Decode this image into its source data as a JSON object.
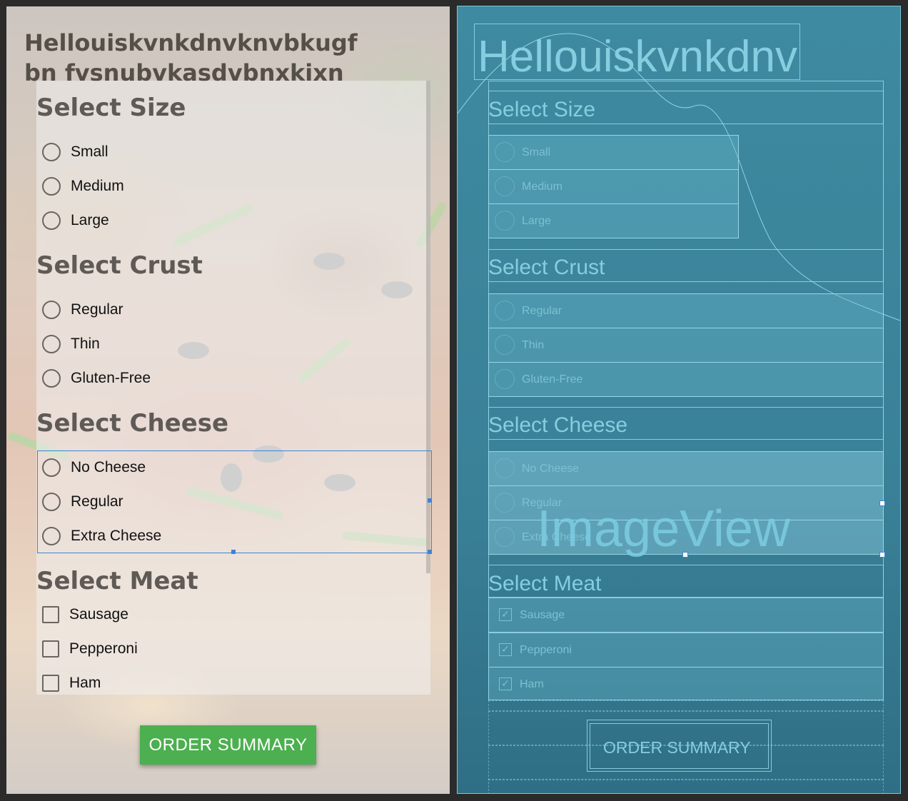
{
  "app": {
    "title": "Hellouiskvnkdnvknvbkugfbn fvsnubvkasdvbnxkixnb",
    "title_blueprint": "Hellouiskvnkdnv"
  },
  "sections": {
    "size": {
      "heading": "Select Size",
      "options": [
        "Small",
        "Medium",
        "Large"
      ]
    },
    "crust": {
      "heading": "Select Crust",
      "options": [
        "Regular",
        "Thin",
        "Gluten-Free"
      ]
    },
    "cheese": {
      "heading": "Select Cheese",
      "options": [
        "No Cheese",
        "Regular",
        "Extra Cheese"
      ]
    },
    "meat": {
      "heading": "Select Meat",
      "options": [
        "Sausage",
        "Pepperoni",
        "Ham"
      ]
    }
  },
  "order_button": {
    "label": "ORDER SUMMARY"
  },
  "blueprint": {
    "imageview_label": "ImageView"
  },
  "colors": {
    "button_green": "#4caf50",
    "selection_blue": "#3d84d6",
    "blueprint_bg": "#2d6d82",
    "blueprint_line": "#7cc7db"
  }
}
